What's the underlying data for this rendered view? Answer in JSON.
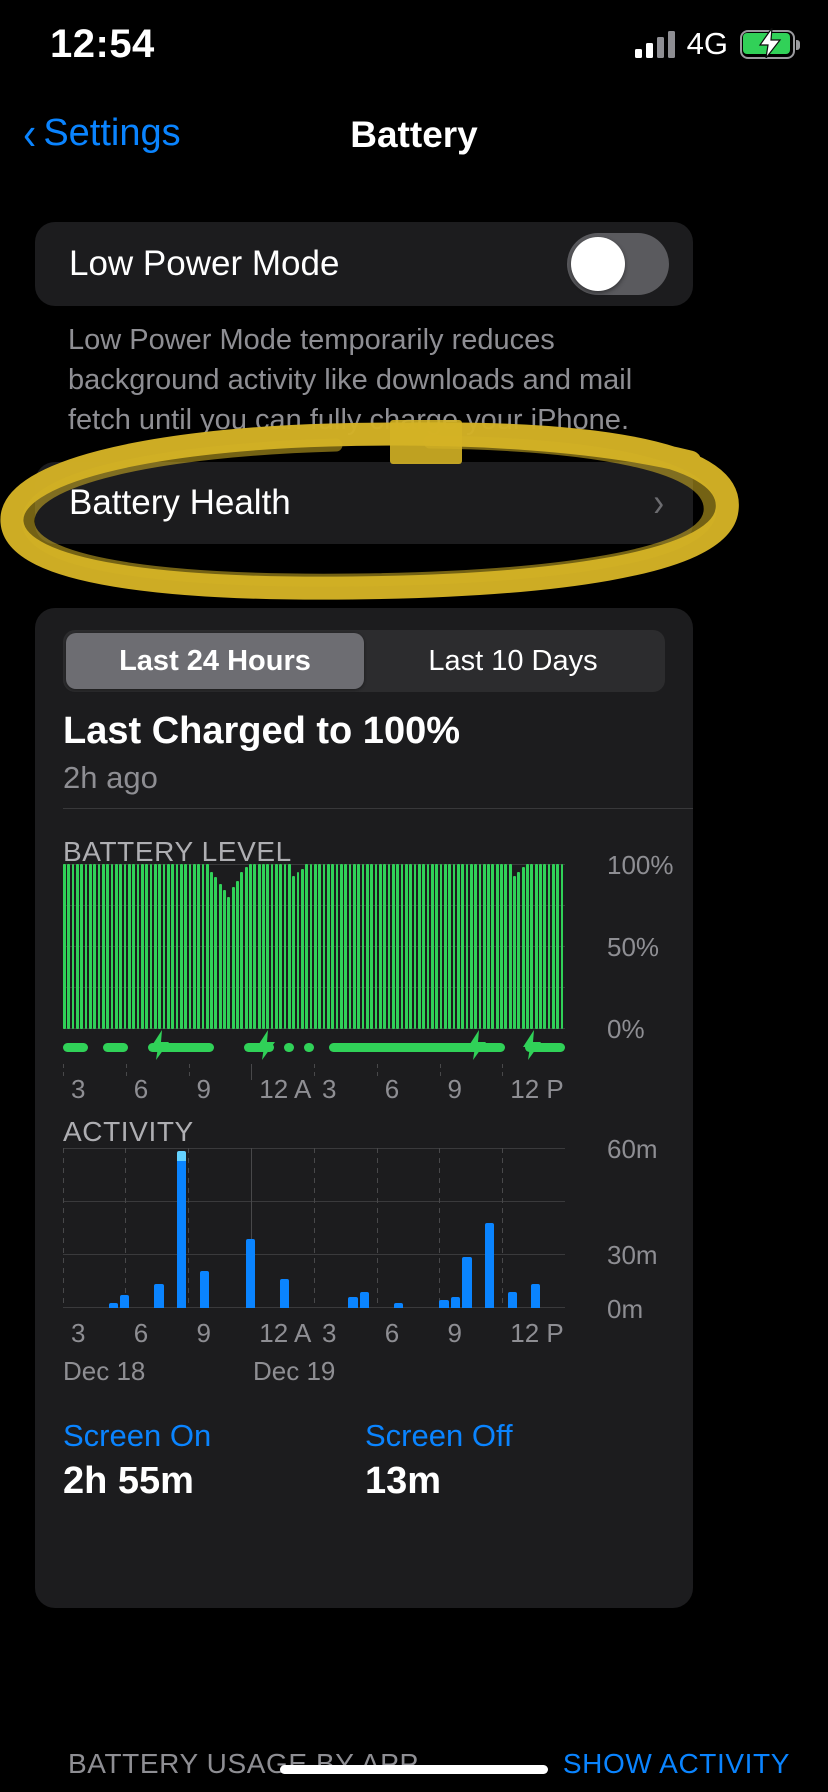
{
  "status_bar": {
    "time": "12:54",
    "network": "4G",
    "signal_bars_filled": 2,
    "signal_bars_total": 4,
    "battery_charging": true,
    "battery_icon": "battery-charging-icon",
    "bolt_glyph": "⚡"
  },
  "nav": {
    "back_label": "Settings",
    "back_icon": "chevron-left-icon",
    "title": "Battery"
  },
  "low_power_mode": {
    "label": "Low Power Mode",
    "enabled": false,
    "description": "Low Power Mode temporarily reduces background activity like downloads and mail fetch until you can fully charge your iPhone."
  },
  "battery_health": {
    "label": "Battery Health",
    "chevron_icon": "chevron-right-icon"
  },
  "annotation": {
    "type": "hand-drawn-ellipse",
    "color": "#d4b225",
    "targets": "battery-health-row"
  },
  "usage": {
    "segments": [
      {
        "label": "Last 24 Hours",
        "selected": true
      },
      {
        "label": "Last 10 Days",
        "selected": false
      }
    ],
    "last_charged_title": "Last Charged to 100%",
    "last_charged_sub": "2h ago",
    "battery_level_title": "BATTERY LEVEL",
    "activity_title": "ACTIVITY",
    "day_labels": [
      "Dec 18",
      "Dec 19"
    ],
    "screen_on_label": "Screen On",
    "screen_on_value": "2h 55m",
    "screen_off_label": "Screen Off",
    "screen_off_value": "13m",
    "bottom_note": "BATTERY USAGE BY APP",
    "bottom_link": "SHOW ACTIVITY"
  },
  "chart_data": [
    {
      "type": "bar",
      "title": "BATTERY LEVEL",
      "xlabel": "",
      "ylabel": "",
      "ylim": [
        0,
        100
      ],
      "ytick_labels": [
        "100%",
        "50%",
        "0%"
      ],
      "ytick_values": [
        100,
        50,
        0
      ],
      "xtick_labels": [
        "3",
        "6",
        "9",
        "12 A",
        "3",
        "6",
        "9",
        "12 P"
      ],
      "series_color": "#30d158",
      "grid": true,
      "values": [
        100,
        100,
        100,
        100,
        100,
        100,
        100,
        100,
        100,
        100,
        100,
        100,
        100,
        100,
        100,
        100,
        100,
        100,
        100,
        100,
        100,
        100,
        100,
        100,
        100,
        100,
        100,
        100,
        100,
        100,
        100,
        100,
        100,
        100,
        95,
        92,
        88,
        84,
        80,
        86,
        90,
        95,
        98,
        100,
        100,
        100,
        100,
        100,
        100,
        100,
        100,
        100,
        100,
        93,
        95,
        97,
        100,
        100,
        100,
        100,
        100,
        100,
        100,
        100,
        100,
        100,
        100,
        100,
        100,
        100,
        100,
        100,
        100,
        100,
        100,
        100,
        100,
        100,
        100,
        100,
        100,
        100,
        100,
        100,
        100,
        100,
        100,
        100,
        100,
        100,
        100,
        100,
        100,
        100,
        100,
        100,
        100,
        100,
        100,
        100,
        100,
        100,
        100,
        100,
        93,
        95,
        98,
        100,
        100,
        100,
        100,
        100,
        100,
        100,
        100,
        100
      ],
      "charging_periods": [
        {
          "start_pct": 0,
          "end_pct": 5
        },
        {
          "start_pct": 8,
          "end_pct": 13
        },
        {
          "start_pct": 17,
          "end_pct": 30
        },
        {
          "start_pct": 36,
          "end_pct": 42
        },
        {
          "start_pct": 44,
          "end_pct": 46
        },
        {
          "start_pct": 48,
          "end_pct": 50
        },
        {
          "start_pct": 53,
          "end_pct": 88
        },
        {
          "start_pct": 92,
          "end_pct": 100
        }
      ],
      "charging_bolt_positions_pct": [
        19,
        40,
        82,
        93
      ]
    },
    {
      "type": "bar",
      "title": "ACTIVITY",
      "xlabel": "",
      "ylabel": "",
      "ylim": [
        0,
        60
      ],
      "ytick_labels": [
        "60m",
        "30m",
        "0m"
      ],
      "ytick_values": [
        60,
        30,
        0
      ],
      "xtick_labels": [
        "3",
        "6",
        "9",
        "12 A",
        "3",
        "6",
        "9",
        "12 P"
      ],
      "series": [
        {
          "name": "Screen On",
          "color": "#0a84ff",
          "values": [
            0,
            0,
            0,
            0,
            2,
            5,
            0,
            0,
            9,
            0,
            55,
            0,
            14,
            0,
            0,
            0,
            26,
            0,
            0,
            11,
            0,
            0,
            0,
            0,
            0,
            4,
            6,
            0,
            0,
            2,
            0,
            0,
            0,
            3,
            4,
            19,
            0,
            32,
            0,
            6,
            0,
            9,
            0,
            0
          ]
        },
        {
          "name": "Screen Off",
          "color": "#64d2ff",
          "values": [
            0,
            0,
            0,
            0,
            0,
            0,
            0,
            0,
            0,
            0,
            4,
            0,
            0,
            0,
            0,
            0,
            0,
            0,
            0,
            0,
            0,
            0,
            0,
            0,
            0,
            0,
            0,
            0,
            0,
            0,
            0,
            0,
            0,
            0,
            0,
            0,
            0,
            0,
            0,
            0,
            0,
            0,
            0,
            0
          ]
        }
      ],
      "grid": true,
      "day_markers": [
        {
          "label": "Dec 18",
          "x_pct": 2
        },
        {
          "label": "Dec 19",
          "x_pct": 43
        }
      ]
    }
  ]
}
